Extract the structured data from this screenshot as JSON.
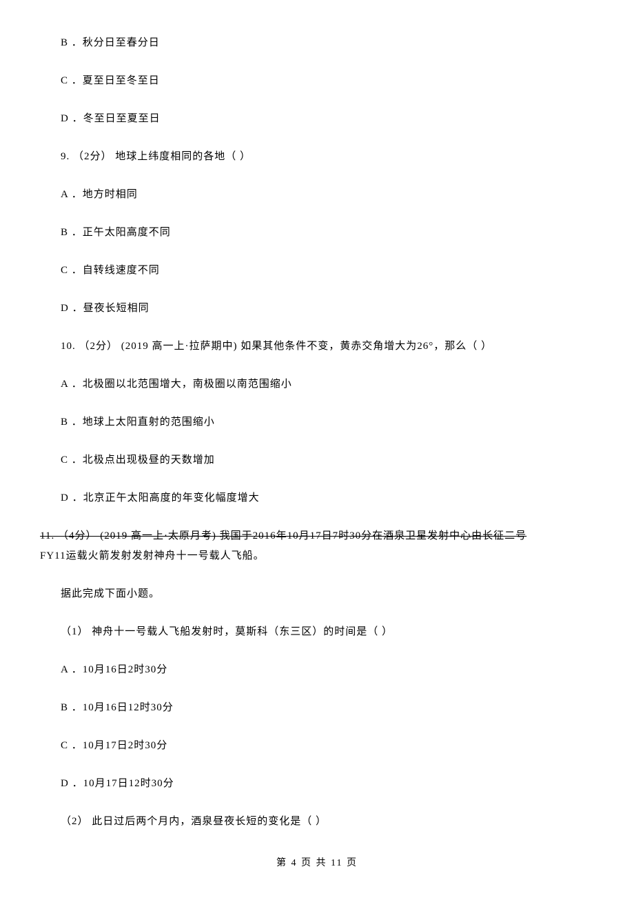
{
  "pre_options": {
    "b": "B ．秋分日至春分日",
    "c": "C ．夏至日至冬至日",
    "d": "D ．冬至日至夏至日"
  },
  "q9": {
    "stem": "9.  （2分）  地球上纬度相同的各地（           ）",
    "a": "A ．地方时相同",
    "b": "B ．正午太阳高度不同",
    "c": "C ．自转线速度不同",
    "d": "D ．昼夜长短相同"
  },
  "q10": {
    "stem": "10.  （2分）  (2019 高一上·拉萨期中)  如果其他条件不变，黄赤交角增大为26°，那么（           ）",
    "a": "A ．北极圈以北范围增大，南极圈以南范围缩小",
    "b": "B ．地球上太阳直射的范围缩小",
    "c": "C ．北极点出现极昼的天数增加",
    "d": "D ．北京正午太阳高度的年变化幅度增大"
  },
  "q11": {
    "stem1": "11.  （4分）   (2019 高一上·太原月考)  我国于2016年10月17日7时30分在酒泉卫星发射中心由长征二号",
    "stem2": "FY11运载火箭发射发射神舟十一号载人飞船。",
    "instruction": "据此完成下面小题。",
    "p1": {
      "stem": "（1） 神舟十一号载人飞船发射时，莫斯科（东三区）的时间是（           ）",
      "a": "A ．10月16日2时30分",
      "b": "B ．10月16日12时30分",
      "c": "C ．10月17日2时30分",
      "d": "D ．10月17日12时30分"
    },
    "p2": {
      "stem": "（2） 此日过后两个月内，酒泉昼夜长短的变化是（           ）"
    }
  },
  "footer": "第 4 页 共 11 页"
}
